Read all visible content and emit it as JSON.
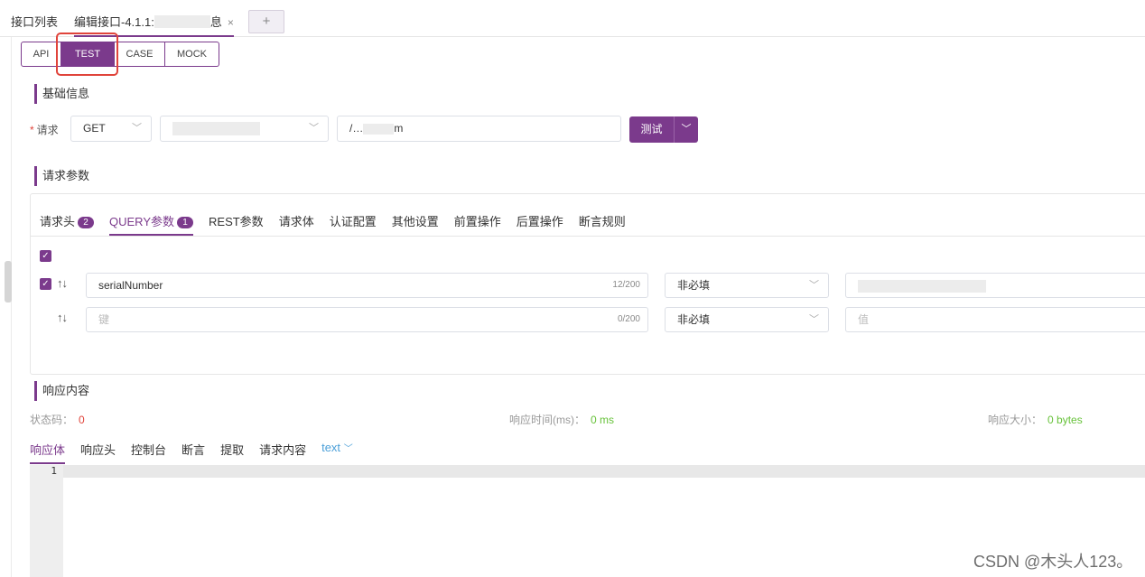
{
  "top_tabs": {
    "list_tab": "接口列表",
    "edit_tab": "编辑接口-4.1.1:",
    "edit_tab_suffix": "息",
    "close": "×",
    "add": "+"
  },
  "mode_tabs": [
    "API",
    "TEST",
    "CASE",
    "MOCK"
  ],
  "mode_active": "TEST",
  "basic": {
    "section_title": "基础信息",
    "request_label": "请求",
    "required_mark": "*",
    "method": "GET",
    "path_value": "/…",
    "path_suffix": "m",
    "test_button": "测试"
  },
  "params": {
    "section_title": "请求参数",
    "tabs": [
      {
        "label": "请求头",
        "badge": "2"
      },
      {
        "label": "QUERY参数",
        "badge": "1"
      },
      {
        "label": "REST参数",
        "badge": ""
      },
      {
        "label": "请求体",
        "badge": ""
      },
      {
        "label": "认证配置",
        "badge": ""
      },
      {
        "label": "其他设置",
        "badge": ""
      },
      {
        "label": "前置操作",
        "badge": ""
      },
      {
        "label": "后置操作",
        "badge": ""
      },
      {
        "label": "断言规则",
        "badge": ""
      }
    ],
    "arrows": "↑↓",
    "rows": [
      {
        "key": "serialNumber",
        "count": "12/200",
        "required": "非必填",
        "value": ""
      },
      {
        "key_placeholder": "键",
        "count": "0/200",
        "required": "非必填",
        "value_placeholder": "值"
      }
    ]
  },
  "response": {
    "section_title": "响应内容",
    "status_label": "状态码：",
    "status_value": "0",
    "time_label": "响应时间(ms)：",
    "time_value": "0 ms",
    "size_label": "响应大小：",
    "size_value": "0 bytes",
    "tabs": [
      "响应体",
      "响应头",
      "控制台",
      "断言",
      "提取",
      "请求内容"
    ],
    "format": "text",
    "line_number": "1"
  },
  "watermark": "CSDN @木头人123。",
  "colors": {
    "accent": "#7b3a8c",
    "highlight": "#e0443b",
    "ok": "#67c23a"
  }
}
